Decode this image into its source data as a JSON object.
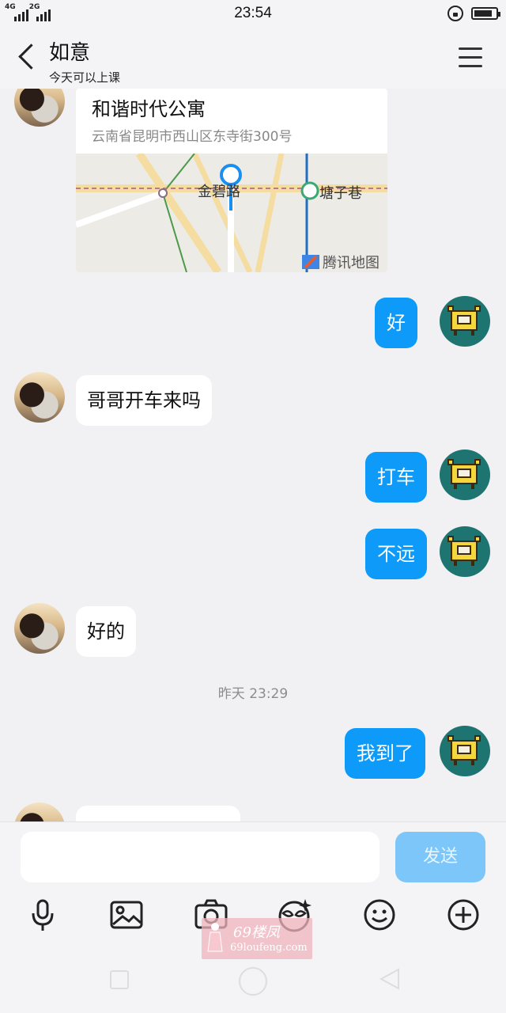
{
  "status_bar": {
    "network": "4G",
    "network2": "2G",
    "time": "23:54",
    "battery_level": 0.85
  },
  "header": {
    "title": "如意",
    "subtitle": "今天可以上课"
  },
  "chat": {
    "location": {
      "name": "和谐时代公寓",
      "address": "云南省昆明市西山区东寺街300号",
      "map_labels": [
        "金碧路",
        "塘子巷",
        "腾讯地图"
      ]
    },
    "messages": [
      {
        "side": "out",
        "text": "好"
      },
      {
        "side": "in",
        "text": "哥哥开车来吗"
      },
      {
        "side": "out",
        "text": "打车"
      },
      {
        "side": "out",
        "text": "不远"
      },
      {
        "side": "in",
        "text": "好的"
      },
      {
        "side": "out",
        "text": "我到了"
      }
    ],
    "timestamp": "昨天 23:29"
  },
  "input_bar": {
    "value": "",
    "send_label": "发送"
  },
  "watermark": {
    "title": "69楼凤",
    "url": "69loufeng.com"
  }
}
